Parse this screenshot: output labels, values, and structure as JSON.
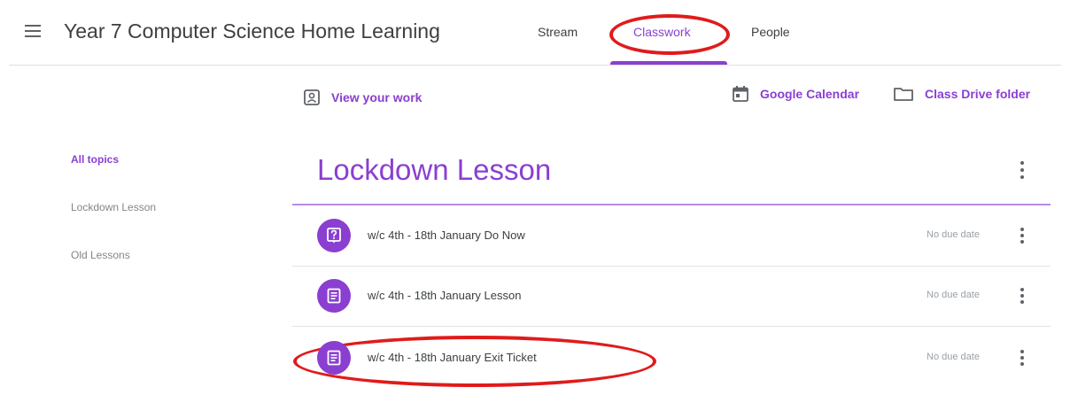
{
  "header": {
    "class_title": "Year 7 Computer Science Home Learning",
    "tabs": [
      {
        "label": "Stream",
        "active": false
      },
      {
        "label": "Classwork",
        "active": true
      },
      {
        "label": "People",
        "active": false
      }
    ]
  },
  "actions": {
    "view_work": "View your work",
    "calendar": "Google Calendar",
    "drive": "Class Drive folder"
  },
  "sidebar": {
    "items": [
      {
        "label": "All topics",
        "active": true
      },
      {
        "label": "Lockdown Lesson",
        "active": false
      },
      {
        "label": "Old Lessons",
        "active": false
      }
    ]
  },
  "topic": {
    "title": "Lockdown Lesson",
    "items": [
      {
        "title": "w/c 4th - 18th January Do Now",
        "due": "No due date",
        "icon": "question-icon"
      },
      {
        "title": "w/c 4th - 18th January Lesson",
        "due": "No due date",
        "icon": "material-icon"
      },
      {
        "title": "w/c 4th - 18th January Exit Ticket",
        "due": "No due date",
        "icon": "material-icon"
      }
    ]
  },
  "colors": {
    "accent": "#8a3fd1",
    "annotation": "#e01b1b"
  }
}
